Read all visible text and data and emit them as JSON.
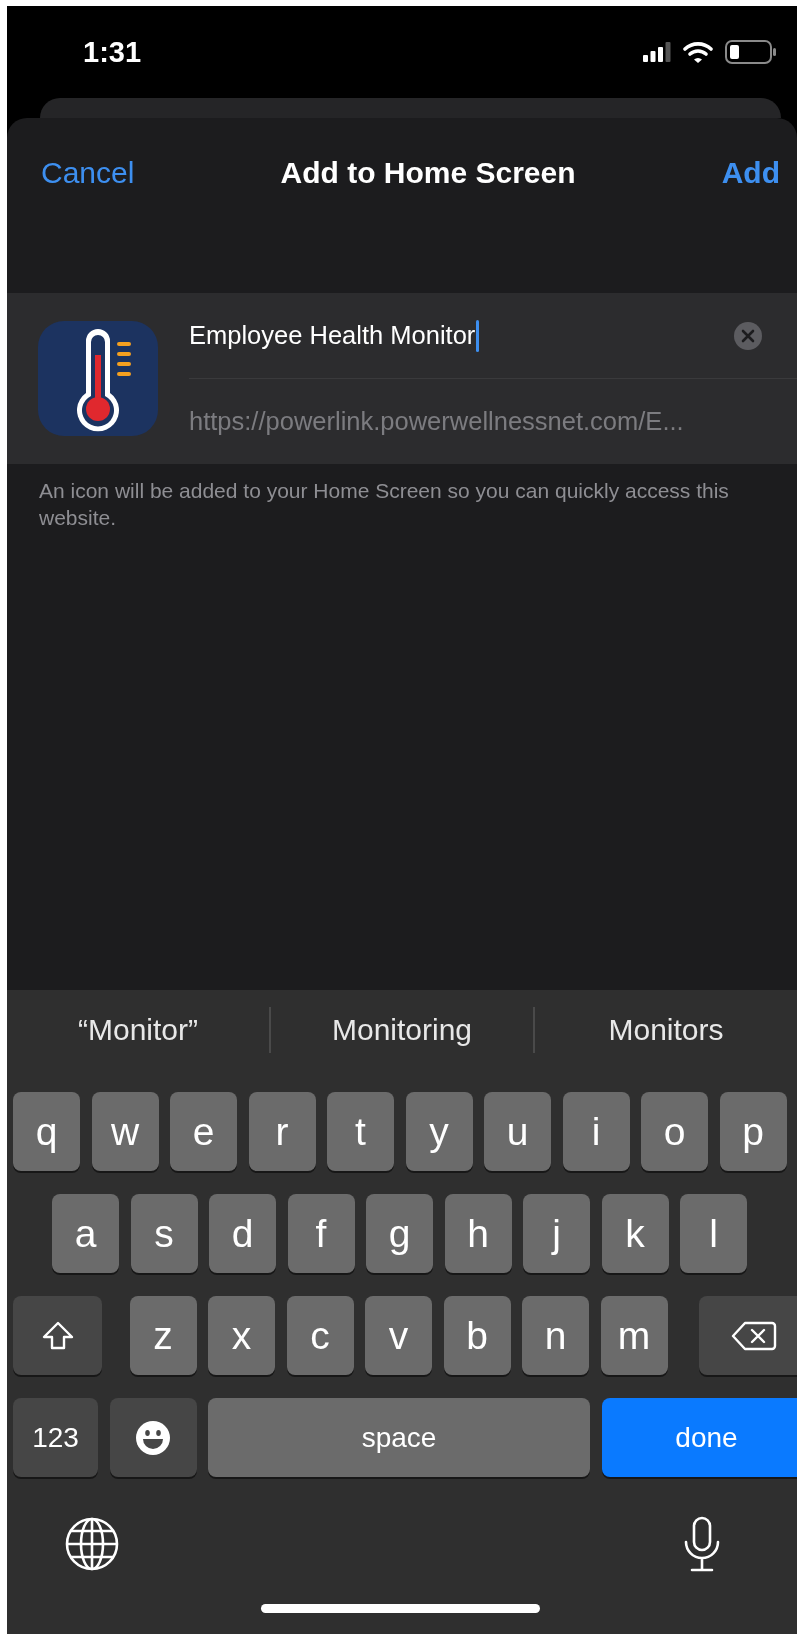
{
  "status_bar": {
    "time": "1:31"
  },
  "nav": {
    "cancel": "Cancel",
    "title": "Add to Home Screen",
    "add": "Add"
  },
  "site": {
    "name": "Employee Health Monitor",
    "url": "https://powerlink.powerwellnessnet.com/E..."
  },
  "footnote": "An icon will be added to your Home Screen so you can quickly access this website.",
  "keyboard": {
    "suggestions": [
      "“Monitor”",
      "Monitoring",
      "Monitors"
    ],
    "rows": [
      [
        {
          "kind": "letter",
          "label": "q"
        },
        {
          "kind": "letter",
          "label": "w"
        },
        {
          "kind": "letter",
          "label": "e"
        },
        {
          "kind": "letter",
          "label": "r"
        },
        {
          "kind": "letter",
          "label": "t"
        },
        {
          "kind": "letter",
          "label": "y"
        },
        {
          "kind": "letter",
          "label": "u"
        },
        {
          "kind": "letter",
          "label": "i"
        },
        {
          "kind": "letter",
          "label": "o"
        },
        {
          "kind": "letter",
          "label": "p"
        }
      ],
      [
        {
          "kind": "letter",
          "label": "a"
        },
        {
          "kind": "letter",
          "label": "s"
        },
        {
          "kind": "letter",
          "label": "d"
        },
        {
          "kind": "letter",
          "label": "f"
        },
        {
          "kind": "letter",
          "label": "g"
        },
        {
          "kind": "letter",
          "label": "h"
        },
        {
          "kind": "letter",
          "label": "j"
        },
        {
          "kind": "letter",
          "label": "k"
        },
        {
          "kind": "letter",
          "label": "l"
        }
      ],
      [
        {
          "kind": "shift"
        },
        {
          "kind": "letter",
          "label": "z"
        },
        {
          "kind": "letter",
          "label": "x"
        },
        {
          "kind": "letter",
          "label": "c"
        },
        {
          "kind": "letter",
          "label": "v"
        },
        {
          "kind": "letter",
          "label": "b"
        },
        {
          "kind": "letter",
          "label": "n"
        },
        {
          "kind": "letter",
          "label": "m"
        },
        {
          "kind": "delete"
        }
      ]
    ],
    "function_keys": [
      {
        "kind": "numbers",
        "label": "123"
      },
      {
        "kind": "emoji"
      },
      {
        "kind": "space",
        "label": "space"
      },
      {
        "kind": "done",
        "label": "done"
      }
    ],
    "bottom": [
      {
        "kind": "globe"
      },
      {
        "kind": "mic"
      }
    ]
  }
}
